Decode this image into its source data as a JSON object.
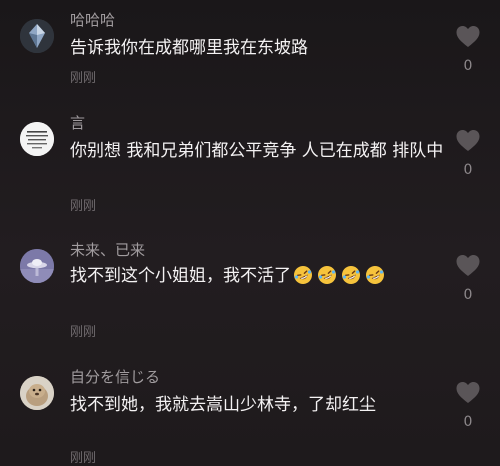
{
  "comments": [
    {
      "username": "哈哈哈",
      "text": "告诉我你在成都哪里我在东坡路",
      "time": "刚刚",
      "likes": "0",
      "avatar_icon": "crystal-icon"
    },
    {
      "username": "言",
      "text": "你别想 我和兄弟们都公平竞争 人已在成都 排队中",
      "time": "刚刚",
      "likes": "0",
      "avatar_icon": "text-card-icon"
    },
    {
      "username": "未来、已来",
      "text": "找不到这个小姐姐，我不活了",
      "time": "刚刚",
      "likes": "0",
      "avatar_icon": "ufo-icon",
      "emojis": [
        "rofl-emoji",
        "rofl-emoji",
        "rofl-emoji",
        "rofl-emoji"
      ]
    },
    {
      "username": "自分を信じる",
      "text": "找不到她，我就去嵩山少林寺，了却红尘",
      "time": "刚刚",
      "likes": "0",
      "avatar_icon": "animal-photo-icon"
    }
  ],
  "colors": {
    "background": "#1d1a1c",
    "username": "#a19c9f",
    "text": "#f4f2f3",
    "time": "#6f6a6d",
    "heart": "#5a5558"
  }
}
